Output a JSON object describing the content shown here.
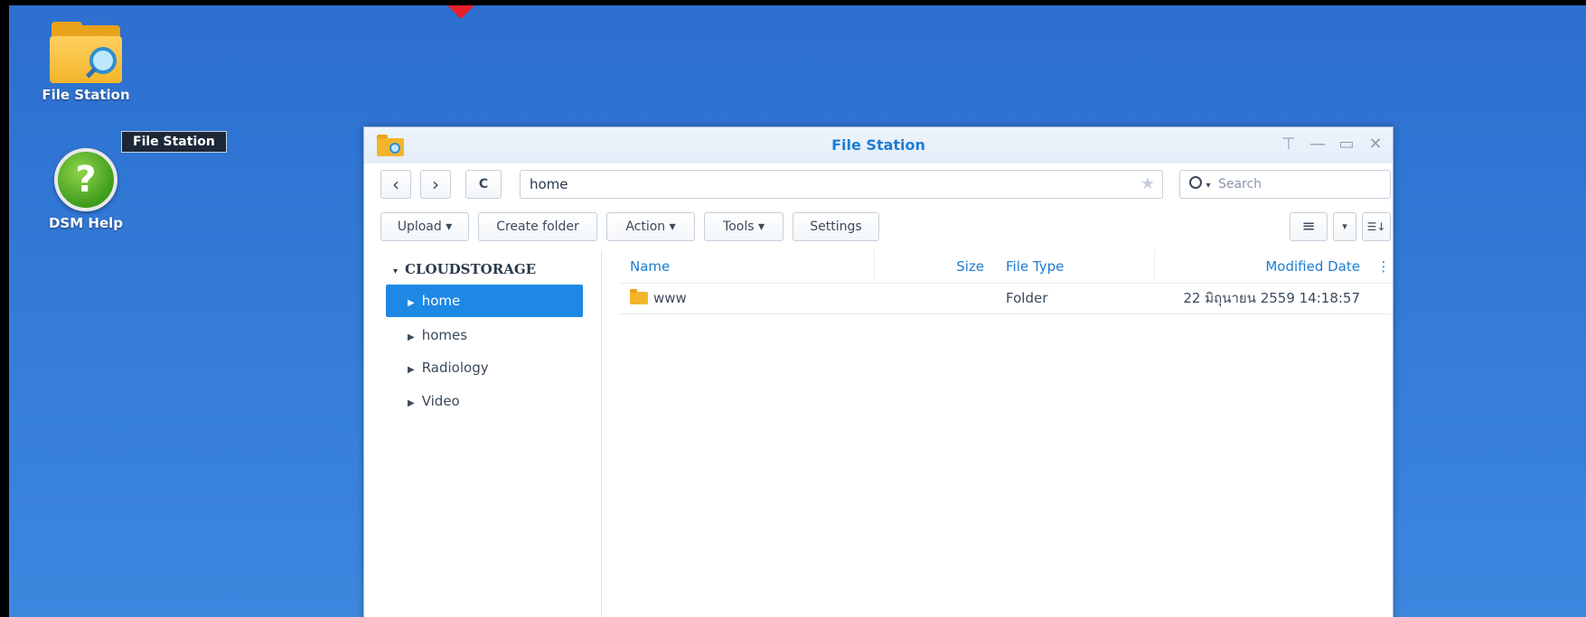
{
  "desktop": {
    "icons": [
      {
        "label": "File Station"
      },
      {
        "label": "DSM Help"
      }
    ],
    "tooltip": "File Station"
  },
  "window": {
    "title": "File Station",
    "controls": {
      "pin": "⊤",
      "minimize": "—",
      "maximize": "▭",
      "close": "✕"
    },
    "nav": {
      "back": "‹",
      "forward": "›",
      "refresh": "C"
    },
    "path": "home",
    "star": "★",
    "search_placeholder": "Search",
    "toolbar": {
      "upload": "Upload ▾",
      "create_folder": "Create folder",
      "action": "Action ▾",
      "tools": "Tools ▾",
      "settings": "Settings",
      "view_list": "≡",
      "view_caret": "▾",
      "sort": "☰↓"
    },
    "tree": {
      "root": "CLOUDSTORAGE",
      "root_caret": "▾",
      "items": [
        {
          "label": "home",
          "active": true
        },
        {
          "label": "homes"
        },
        {
          "label": "Radiology"
        },
        {
          "label": "Video"
        }
      ]
    },
    "filelist": {
      "columns": {
        "name": "Name",
        "size": "Size",
        "type": "File Type",
        "modified": "Modified Date",
        "more": "⋮"
      },
      "rows": [
        {
          "name": "www",
          "size": "",
          "type": "Folder",
          "modified": "22 มิถุนายน 2559 14:18:57"
        }
      ]
    }
  }
}
